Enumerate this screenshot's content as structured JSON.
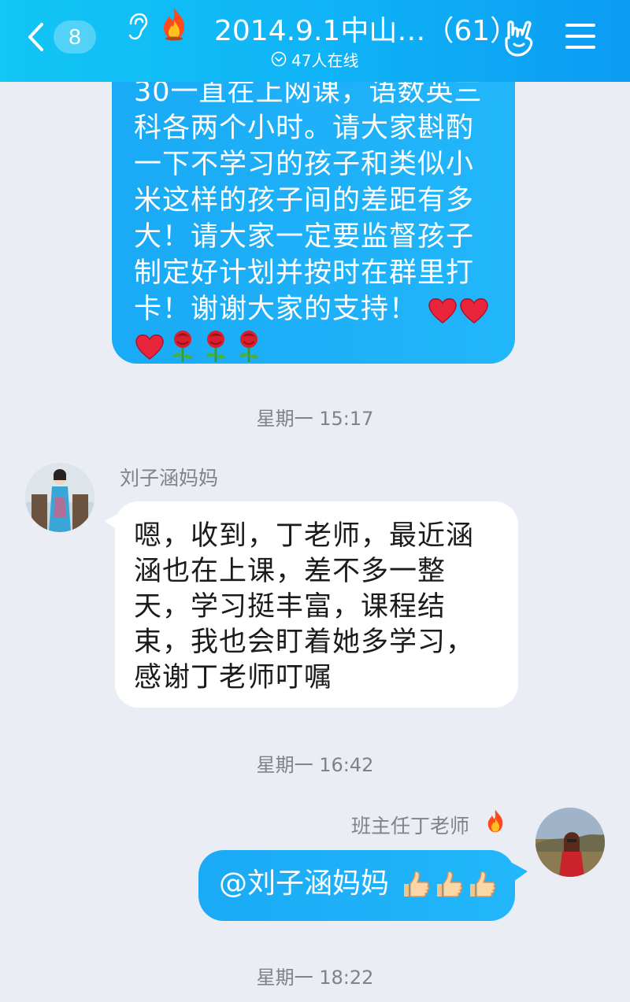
{
  "header": {
    "back_count": "8",
    "title": "2014.9.1中山…（61）",
    "online": "47人在线"
  },
  "messages": [
    {
      "text": "30一直在上网课，语数英三科各两个小时。请大家斟酌一下不学习的孩子和类似小米这样的孩子间的差距有多大！请大家一定要监督孩子制定好计划并按时在群里打卡！谢谢大家的支持！"
    },
    {
      "time": "星期一 15:17",
      "sender": "刘子涵妈妈",
      "text": "嗯，收到，丁老师，最近涵涵也在上课，差不多一整天，学习挺丰富，课程结束，我也会盯着她多学习，感谢丁老师叮嘱"
    },
    {
      "time": "星期一 16:42",
      "sender": "班主任丁老师",
      "text": "@刘子涵妈妈"
    },
    {
      "time": "星期一 18:22"
    }
  ],
  "colors": {
    "header_start": "#12c6f5",
    "header_end": "#0c9cf3",
    "bubble_blue": "#1aaaf6",
    "background": "#ebedf5"
  }
}
